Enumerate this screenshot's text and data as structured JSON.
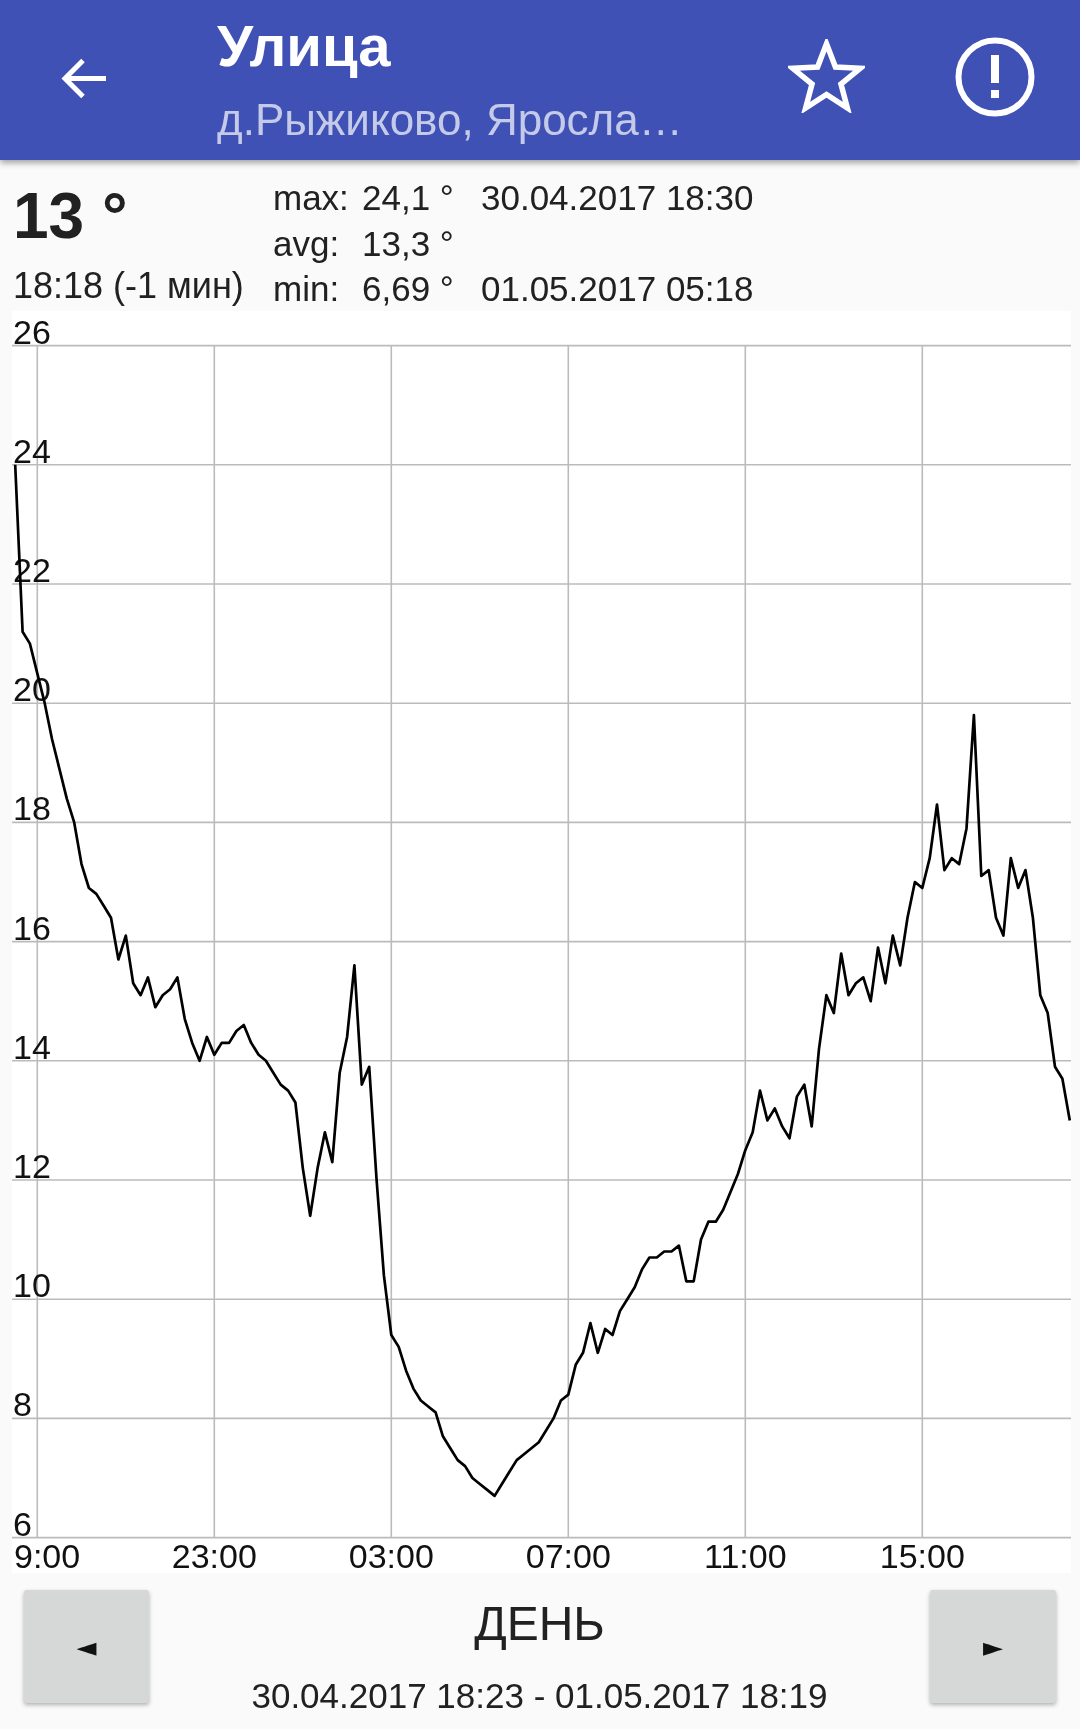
{
  "toolbar": {
    "title": "Улица",
    "subtitle": "д.Рыжиково, Яросла…"
  },
  "current": {
    "temperature": "13 °",
    "time": "18:18 (-1 мин)"
  },
  "stats": [
    {
      "label": "max:",
      "value": "24,1 °",
      "time": "30.04.2017 18:30"
    },
    {
      "label": "avg:",
      "value": "13,3 °"
    },
    {
      "label": "min:",
      "value": "6,69 °",
      "time": "01.05.2017 05:18"
    }
  ],
  "chart": {
    "chart_data": {
      "type": "line",
      "grid": true,
      "ylim": [
        6,
        26
      ],
      "yticks": [
        6,
        8,
        10,
        12,
        14,
        16,
        18,
        20,
        22,
        24,
        26
      ],
      "categories": [
        null,
        null,
        null,
        null,
        "9:00",
        null,
        null,
        null,
        null,
        null,
        null,
        null,
        null,
        null,
        null,
        null,
        null,
        null,
        null,
        null,
        null,
        null,
        null,
        null,
        null,
        null,
        null,
        null,
        "23:00",
        null,
        null,
        null,
        null,
        null,
        null,
        null,
        null,
        null,
        null,
        null,
        null,
        null,
        null,
        null,
        null,
        null,
        null,
        null,
        null,
        null,
        null,
        null,
        "03:00",
        null,
        null,
        null,
        null,
        null,
        null,
        null,
        null,
        null,
        null,
        null,
        null,
        null,
        null,
        null,
        null,
        null,
        null,
        null,
        null,
        null,
        null,
        null,
        "07:00",
        null,
        null,
        null,
        null,
        null,
        null,
        null,
        null,
        null,
        null,
        null,
        null,
        null,
        null,
        null,
        null,
        null,
        null,
        null,
        null,
        null,
        null,
        null,
        "11:00",
        null,
        null,
        null,
        null,
        null,
        null,
        null,
        null,
        null,
        null,
        null,
        null,
        null,
        null,
        null,
        null,
        null,
        null,
        null,
        null,
        null,
        null,
        null,
        "15:00",
        null,
        null,
        null,
        null,
        null,
        null,
        null,
        null,
        null,
        null,
        null,
        null,
        null,
        null,
        null,
        null,
        null,
        null,
        null,
        null
      ],
      "values": [
        null,
        24.0,
        21.2,
        21.0,
        20.5,
        20.0,
        19.4,
        18.9,
        18.4,
        18.0,
        17.3,
        16.9,
        16.8,
        16.6,
        16.4,
        15.7,
        16.1,
        15.3,
        15.1,
        15.4,
        14.9,
        15.1,
        15.2,
        15.4,
        14.7,
        14.3,
        14.0,
        14.4,
        14.1,
        14.3,
        14.3,
        14.5,
        14.6,
        14.3,
        14.1,
        14.0,
        13.8,
        13.6,
        13.5,
        13.3,
        12.2,
        11.4,
        12.2,
        12.8,
        12.3,
        13.8,
        14.4,
        15.6,
        13.6,
        13.9,
        12.0,
        10.4,
        9.4,
        9.2,
        8.8,
        8.5,
        8.3,
        8.2,
        8.1,
        7.7,
        7.5,
        7.3,
        7.2,
        7.0,
        6.9,
        6.8,
        6.7,
        6.9,
        7.1,
        7.3,
        7.4,
        7.5,
        7.6,
        7.8,
        8.0,
        8.3,
        8.4,
        8.9,
        9.1,
        9.6,
        9.1,
        9.5,
        9.4,
        9.8,
        10.0,
        10.2,
        10.5,
        10.7,
        10.7,
        10.8,
        10.8,
        10.9,
        10.3,
        10.3,
        11.0,
        11.3,
        11.3,
        11.5,
        11.8,
        12.1,
        12.5,
        12.8,
        13.5,
        13.0,
        13.2,
        12.9,
        12.7,
        13.4,
        13.6,
        12.9,
        14.2,
        15.1,
        14.8,
        15.8,
        15.1,
        15.3,
        15.4,
        15.0,
        15.9,
        15.3,
        16.1,
        15.6,
        16.4,
        17.0,
        16.9,
        17.4,
        18.3,
        17.2,
        17.4,
        17.3,
        17.9,
        19.8,
        17.1,
        17.2,
        16.4,
        16.1,
        17.4,
        16.9,
        17.2,
        16.4,
        15.1,
        14.8,
        13.9,
        13.7,
        13.0
      ]
    }
  },
  "period": {
    "previous": "◄",
    "label": "ДЕНЬ",
    "range": "30.04.2017 18:23 - 01.05.2017 18:19",
    "next": "►"
  }
}
